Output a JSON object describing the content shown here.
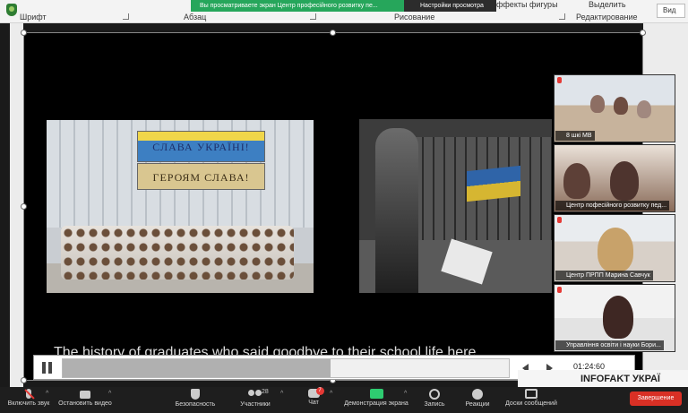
{
  "ribbon": {
    "groups": [
      "Шрифт",
      "Абзац",
      "Рисование",
      "Редактирование"
    ],
    "top_items": [
      "ффекты фигуры",
      "Выделить"
    ],
    "share_banner": "Вы просматриваете экран Центр професійного розвитку пе...",
    "view_settings": "Настройки просмотра",
    "right_button": "Вид"
  },
  "slide": {
    "banner_top": "СЛАВА УКРАЇНІ!",
    "banner_bottom": "ГЕРОЯМ СЛАВА!",
    "caption": "The history of graduates who said goodbye to their school life here"
  },
  "video": {
    "timecode": "01:24:60",
    "progress": 0.6
  },
  "participants": [
    {
      "name": "8 шкі МВ"
    },
    {
      "name": "Центр пофесійного розвитку пед..."
    },
    {
      "name": "Центр ПРПП Марина Савчук"
    },
    {
      "name": "Управління освіти і науки Бори..."
    }
  ],
  "overlay": {
    "infofakt": "INFOFAKT УКРАЇ"
  },
  "toolbar": {
    "mute": "Включить звук",
    "video": "Остановить видео",
    "security": "Безопасность",
    "participants": "Участники",
    "participant_count": "28",
    "chat": "Чат",
    "chat_badge": "7",
    "share": "Демонстрация экрана",
    "record": "Запись",
    "reactions": "Реакции",
    "whiteboard": "Доски сообщений",
    "end": "Завершение"
  },
  "colors": {
    "share_green": "#26a65b",
    "end_red": "#d93025",
    "toolbar_bg": "#1e1e1e"
  }
}
